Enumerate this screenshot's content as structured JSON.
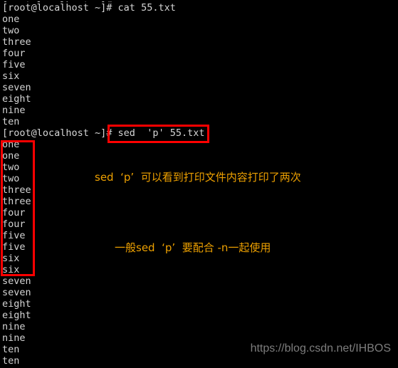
{
  "terminal": {
    "background_color": "#000000",
    "text_color": "#d5d5d5",
    "lines": [
      "[root@localhost ~]#",
      "[root@localhost ~]# cat 55.txt",
      "one",
      "two",
      "three",
      "four",
      "five",
      "six",
      "seven",
      "eight",
      "nine",
      "ten",
      "[root@localhost ~]# sed  'p' 55.txt",
      "one",
      "one",
      "two",
      "two",
      "three",
      "three",
      "four",
      "four",
      "five",
      "five",
      "six",
      "six",
      "seven",
      "seven",
      "eight",
      "eight",
      "nine",
      "nine",
      "ten",
      "ten"
    ]
  },
  "highlights": {
    "color": "#ff0000",
    "command_box_label": "sed  'p' 55.txt",
    "output_box_label": "one one two two three three four four five five six six"
  },
  "annotations": {
    "color": "#eda000",
    "first": "sed  ‘p’  可以看到打印文件内容打印了两次",
    "second": "一般sed  ‘p’  要配合 -n一起使用"
  },
  "watermark": {
    "text": "https://blog.csdn.net/IHBOS",
    "color": "#7d7d7d"
  }
}
